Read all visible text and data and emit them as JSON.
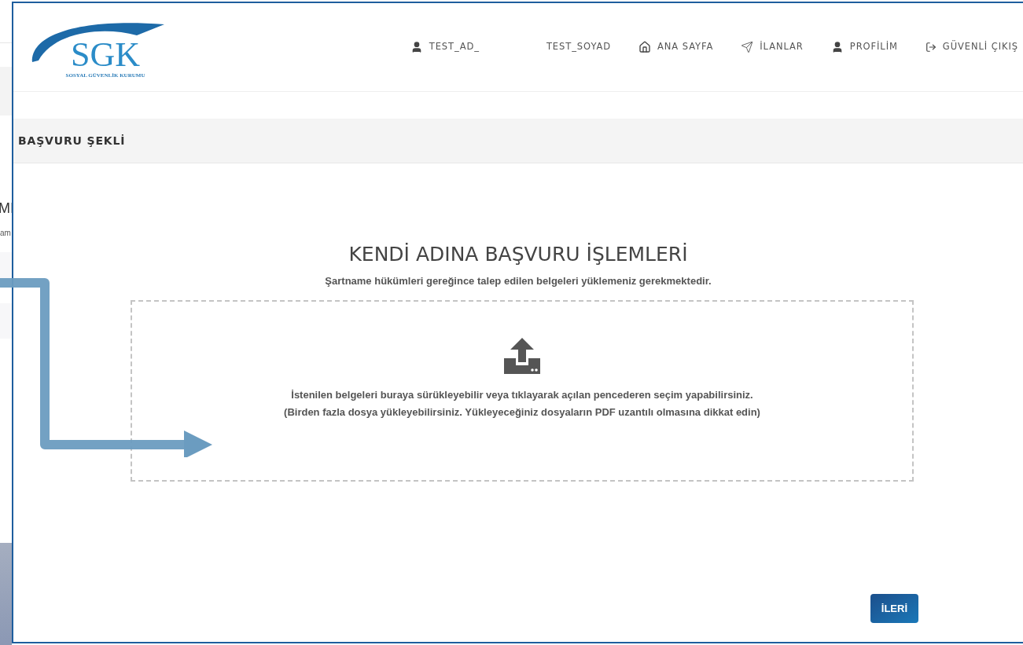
{
  "background_page": {
    "heading_fragment": "MI",
    "text_fragment": "am"
  },
  "header": {
    "logo": {
      "wordmark": "SGK",
      "subtitle": "SOSYAL GÜVENLİK KURUMU"
    },
    "nav": [
      {
        "kind": "user",
        "label": "TEST_AD_"
      },
      {
        "kind": "text",
        "label": "TEST_SOYAD"
      },
      {
        "kind": "home",
        "label": "ANA SAYFA"
      },
      {
        "kind": "send",
        "label": "İLANLAR"
      },
      {
        "kind": "user",
        "label": "PROFİLİM"
      },
      {
        "kind": "logout",
        "label": "GÜVENLİ ÇIKIŞ"
      }
    ]
  },
  "section_bar": {
    "title": "BAŞVURU ŞEKLİ"
  },
  "main": {
    "title": "KENDİ ADINA BAŞVURU İŞLEMLERİ",
    "subtitle": "Şartname hükümleri gereğince talep edilen belgeleri yüklemeniz gerekmektedir.",
    "dropzone": {
      "lines": [
        "İstenilen belgeleri buraya sürükleyebilir veya tıklayarak açılan pencederen seçim yapabilirsiniz.",
        "(Birden fazla dosya yükleyebilirsiniz. Yükleyeceğiniz dosyaların PDF uzantılı olmasına dikkat edin)"
      ]
    },
    "next_button": "İLERİ"
  }
}
